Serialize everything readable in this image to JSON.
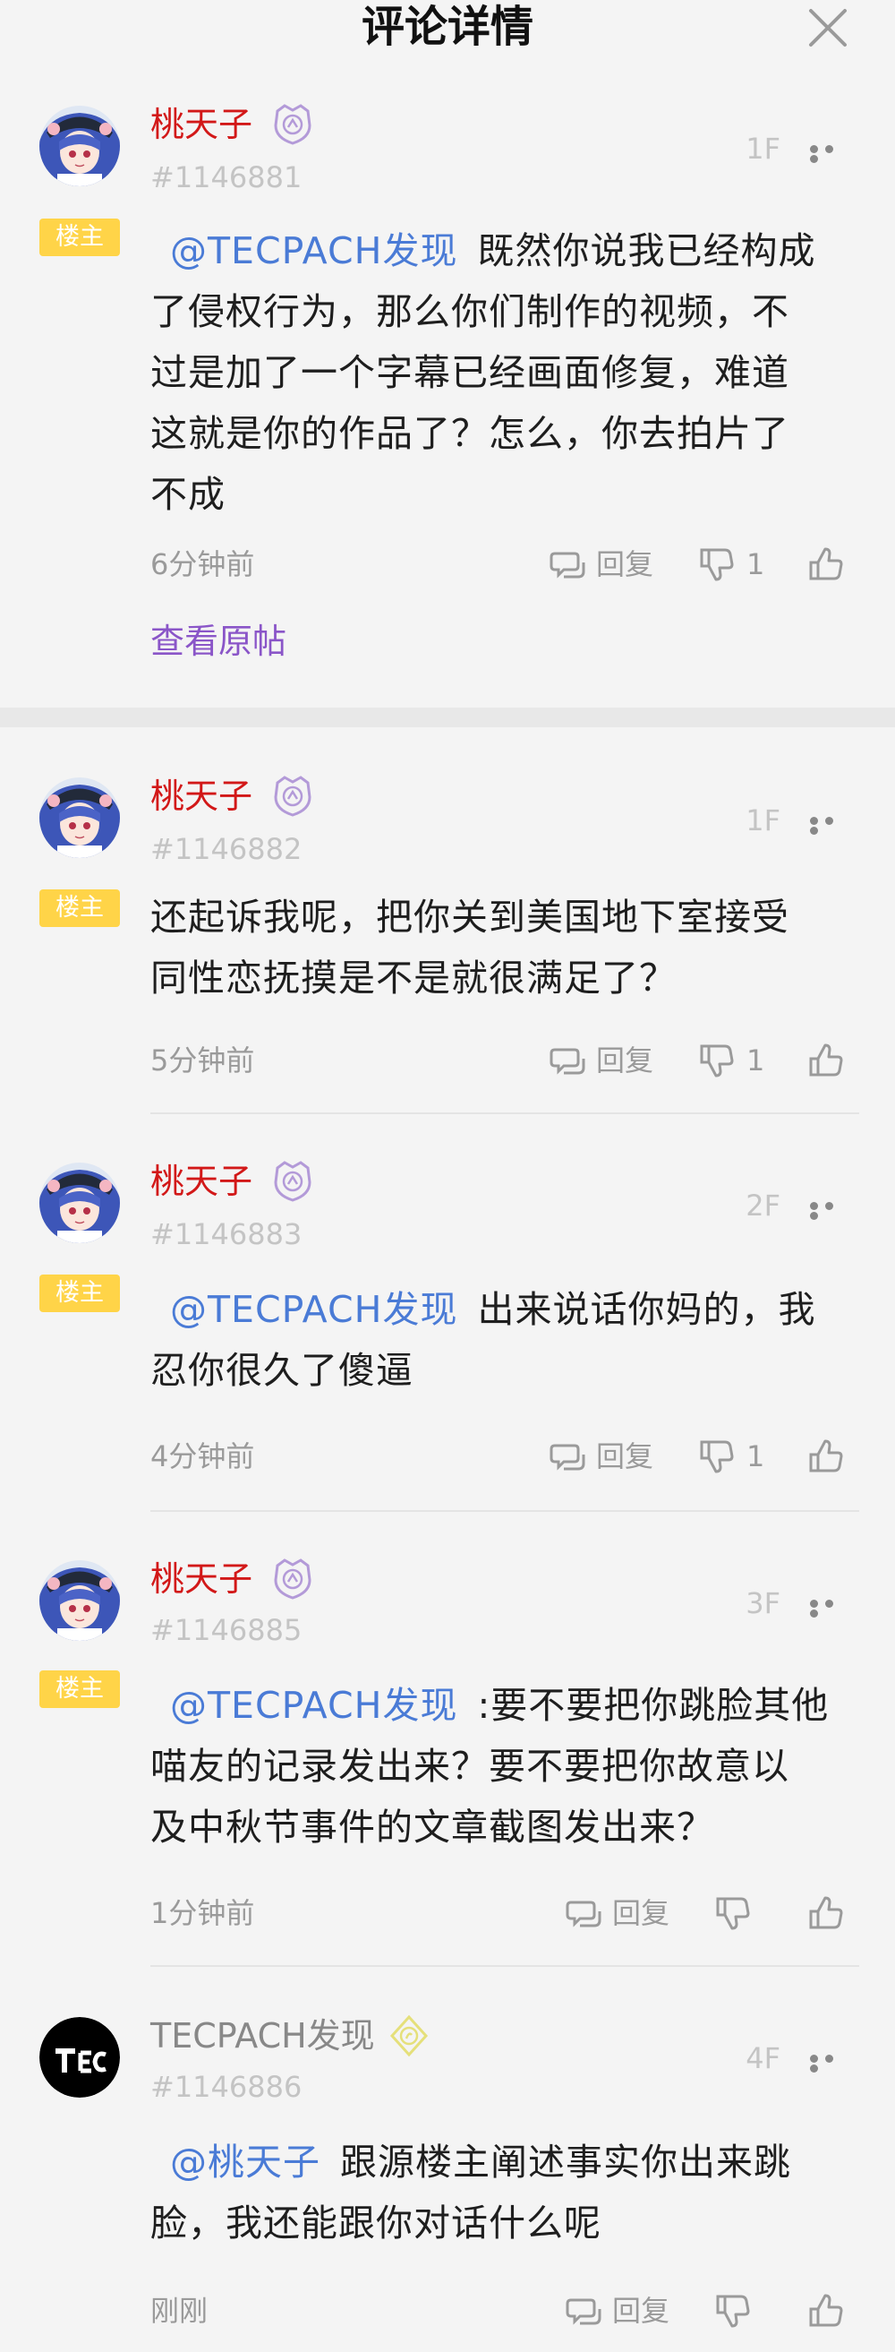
{
  "header": {
    "title": "评论详情"
  },
  "view_original": "查看原帖",
  "host_badge": "楼主",
  "comments": [
    {
      "username": "桃天子",
      "uid": "#1146881",
      "floor": "1F",
      "mention": "@TECPACH发现",
      "text1": "既然你说我已经构成",
      "text2": "了侵权行为，那么你们制作的视频，不",
      "text3": "过是加了一个字幕已经画面修复，难道",
      "text4": "这就是你的作品了？怎么，你去拍片了",
      "text5": "不成",
      "time": "6分钟前",
      "reply": "回复",
      "dislike_count": "1"
    },
    {
      "username": "桃天子",
      "uid": "#1146882",
      "floor": "1F",
      "text1": "还起诉我呢，把你关到美国地下室接受",
      "text2": "同性恋抚摸是不是就很满足了？",
      "time": "5分钟前",
      "reply": "回复",
      "dislike_count": "1"
    },
    {
      "username": "桃天子",
      "uid": "#1146883",
      "floor": "2F",
      "mention": "@TECPACH发现",
      "text1": "出来说话你妈的，我",
      "text2": "忍你很久了傻逼",
      "time": "4分钟前",
      "reply": "回复",
      "dislike_count": "1"
    },
    {
      "username": "桃天子",
      "uid": "#1146885",
      "floor": "3F",
      "mention": "@TECPACH发现",
      "text1": ":要不要把你跳脸其他",
      "text2": "喵友的记录发出来？要不要把你故意以",
      "text3": "及中秋节事件的文章截图发出来？",
      "time": "1分钟前",
      "reply": "回复"
    },
    {
      "username": "TECPACH发现",
      "uid": "#1146886",
      "floor": "4F",
      "mention": "@桃天子",
      "text1": "跟源楼主阐述事实你出来跳",
      "text2": "脸，我还能跟你对话什么呢",
      "time": "刚刚",
      "reply": "回复"
    }
  ],
  "icons": [
    "close-icon",
    "avatar",
    "verified-badge-icon",
    "more-icon",
    "reply-icon",
    "dislike-icon",
    "like-icon"
  ],
  "colors": {
    "username_red": "#d21818",
    "mention_blue": "#4a7bd6",
    "link_purple": "#8a55c8",
    "host_badge": "#ffd448"
  }
}
